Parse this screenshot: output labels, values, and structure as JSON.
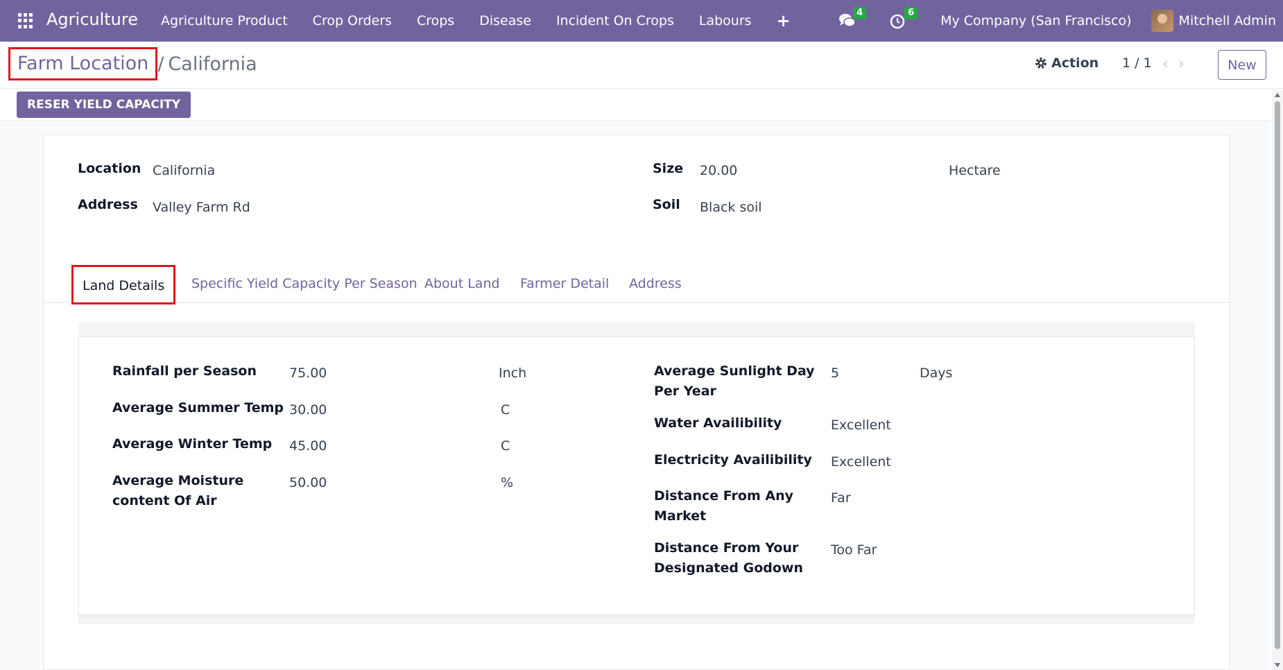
{
  "navbar": {
    "app_name": "Agriculture",
    "menu": [
      "Agriculture Product",
      "Crop Orders",
      "Crops",
      "Disease",
      "Incident On Crops",
      "Labours"
    ],
    "plus": "+",
    "messages_count": "4",
    "activities_count": "6",
    "company": "My Company (San Francisco)",
    "user": "Mitchell Admin"
  },
  "breadcrumb": {
    "parent": "Farm Location",
    "separator": "/",
    "current": "California"
  },
  "control": {
    "action_label": "Action",
    "pager": "1 / 1",
    "new_label": "New"
  },
  "statusbar": {
    "reset_label": "RESER YIELD CAPACITY"
  },
  "form": {
    "location_label": "Location",
    "location_value": "California",
    "address_label": "Address",
    "address_value": "Valley Farm Rd",
    "size_label": "Size",
    "size_value": "20.00",
    "size_unit": "Hectare",
    "soil_label": "Soil",
    "soil_value": "Black soil"
  },
  "tabs": [
    "Land Details",
    "Specific Yield Capacity Per Season",
    "About Land",
    "Farmer Detail",
    "Address"
  ],
  "land_details": {
    "rainfall_label": "Rainfall per Season",
    "rainfall_value": "75.00",
    "rainfall_unit": "Inch",
    "summer_label": "Average Summer Temp",
    "summer_value": "30.00",
    "summer_unit": "C",
    "winter_label": "Average Winter Temp",
    "winter_value": "45.00",
    "winter_unit": "C",
    "moisture_label_1": "Average Moisture",
    "moisture_label_2": "content Of Air",
    "moisture_value": "50.00",
    "moisture_unit": "%",
    "sunlight_label_1": "Average Sunlight Day",
    "sunlight_label_2": "Per Year",
    "sunlight_value": "5",
    "sunlight_unit": "Days",
    "water_label": "Water Availibility",
    "water_value": "Excellent",
    "electricity_label": "Electricity Availibility",
    "electricity_value": "Excellent",
    "market_label_1": "Distance From Any",
    "market_label_2": "Market",
    "market_value": "Far",
    "godown_label_1": "Distance From Your",
    "godown_label_2": "Designated Godown",
    "godown_value": "Too Far"
  }
}
